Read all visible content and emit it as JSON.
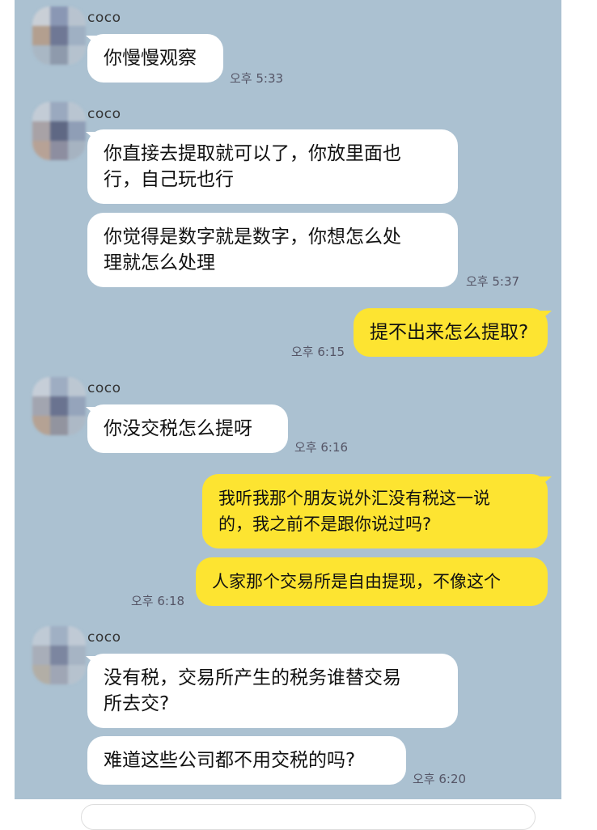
{
  "messages": {
    "m1": {
      "sender": "coco",
      "text": "你慢慢观察",
      "time": "오후 5:33"
    },
    "m2": {
      "sender": "coco",
      "text": "你直接去提取就可以了，你放里面也\n行，自己玩也行"
    },
    "m3": {
      "text": "你觉得是数字就是数字，你想怎么处\n理就怎么处理",
      "time": "오후 5:37"
    },
    "m4": {
      "text": "提不出来怎么提取?",
      "time": "오후 6:15"
    },
    "m5": {
      "sender": "coco",
      "text": "你没交税怎么提呀",
      "time": "오후 6:16"
    },
    "m6": {
      "text": "我听我那个朋友说外汇没有税这一说\n的，我之前不是跟你说过吗?"
    },
    "m7": {
      "text": "人家那个交易所是自由提现，不像这个",
      "time": "오후 6:18"
    },
    "m8": {
      "sender": "coco",
      "text": "没有税，交易所产生的税务谁替交易\n所去交?"
    },
    "m9": {
      "text": "难道这些公司都不用交税的吗?",
      "time": "오후 6:20"
    }
  },
  "colors": {
    "chat_bg": "#abc1d1",
    "outgoing": "#fde431",
    "incoming": "#ffffff"
  }
}
